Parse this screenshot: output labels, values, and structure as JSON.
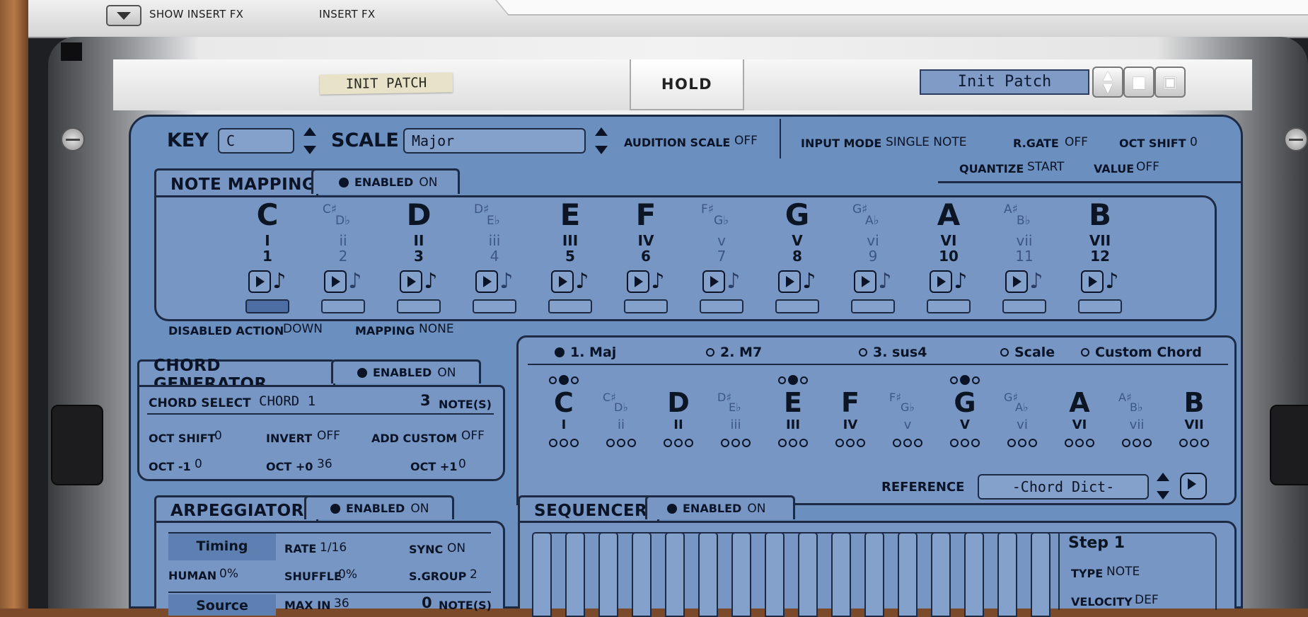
{
  "topbar": {
    "show_insert_fx": "SHOW INSERT FX",
    "insert_fx": "INSERT FX"
  },
  "header": {
    "patch_label": "INIT PATCH",
    "hold": "HOLD",
    "patch_name": "Init Patch"
  },
  "scale_bar": {
    "key_label": "KEY",
    "key_value": "C",
    "scale_label": "SCALE",
    "scale_value": "Major",
    "audition_label": "AUDITION SCALE",
    "audition_value": "OFF",
    "input_mode_label": "INPUT MODE",
    "input_mode_value": "SINGLE NOTE",
    "rgate_label": "R.GATE",
    "rgate_value": "OFF",
    "oct_shift_label": "OCT SHIFT",
    "oct_shift_value": "0",
    "quantize_label": "QUANTIZE",
    "quantize_value": "START",
    "value_label": "VALUE",
    "value_value": "OFF"
  },
  "note_mapping": {
    "title": "NOTE MAPPING",
    "enabled_label": "ENABLED",
    "enabled_value": "ON",
    "disabled_action_label": "DISABLED ACTION",
    "disabled_action_value": "DOWN",
    "mapping_label": "MAPPING",
    "mapping_value": "NONE",
    "notes": [
      {
        "name": "C",
        "sharp": "",
        "flat": "",
        "roman": "I",
        "num": "1",
        "dim": false
      },
      {
        "name": "",
        "sharp": "C♯",
        "flat": "D♭",
        "roman": "ii",
        "num": "2",
        "dim": true
      },
      {
        "name": "D",
        "sharp": "",
        "flat": "",
        "roman": "II",
        "num": "3",
        "dim": false
      },
      {
        "name": "",
        "sharp": "D♯",
        "flat": "E♭",
        "roman": "iii",
        "num": "4",
        "dim": true
      },
      {
        "name": "E",
        "sharp": "",
        "flat": "",
        "roman": "III",
        "num": "5",
        "dim": false
      },
      {
        "name": "F",
        "sharp": "",
        "flat": "",
        "roman": "IV",
        "num": "6",
        "dim": false
      },
      {
        "name": "",
        "sharp": "F♯",
        "flat": "G♭",
        "roman": "v",
        "num": "7",
        "dim": true
      },
      {
        "name": "G",
        "sharp": "",
        "flat": "",
        "roman": "V",
        "num": "8",
        "dim": false
      },
      {
        "name": "",
        "sharp": "G♯",
        "flat": "A♭",
        "roman": "vi",
        "num": "9",
        "dim": true
      },
      {
        "name": "A",
        "sharp": "",
        "flat": "",
        "roman": "VI",
        "num": "10",
        "dim": false
      },
      {
        "name": "",
        "sharp": "A♯",
        "flat": "B♭",
        "roman": "vii",
        "num": "11",
        "dim": true
      },
      {
        "name": "B",
        "sharp": "",
        "flat": "",
        "roman": "VII",
        "num": "12",
        "dim": false
      }
    ]
  },
  "chord_generator": {
    "title": "CHORD GENERATOR",
    "enabled_label": "ENABLED",
    "enabled_value": "ON",
    "chord_select_label": "CHORD SELECT",
    "chord_select_value": "CHORD 1",
    "note_count": "3",
    "notes_label": "NOTE(S)",
    "oct_shift_label": "OCT SHIFT",
    "oct_shift_value": "0",
    "invert_label": "INVERT",
    "invert_value": "OFF",
    "add_custom_label": "ADD CUSTOM",
    "add_custom_value": "OFF",
    "oct_m1_label": "OCT -1",
    "oct_m1_value": "0",
    "oct_0_label": "OCT +0",
    "oct_0_value": "36",
    "oct_p1_label": "OCT +1",
    "oct_p1_value": "0",
    "options": [
      {
        "label": "1. Maj",
        "selected": true
      },
      {
        "label": "2. M7",
        "selected": false
      },
      {
        "label": "3. sus4",
        "selected": false
      },
      {
        "label": "Scale",
        "selected": false
      },
      {
        "label": "Custom Chord",
        "selected": false
      }
    ],
    "reference_label": "REFERENCE",
    "reference_value": "-Chord Dict-",
    "columns": [
      {
        "name": "C",
        "sharp": "",
        "flat": "",
        "roman": "I",
        "active": true,
        "dim": false
      },
      {
        "name": "",
        "sharp": "C♯",
        "flat": "D♭",
        "roman": "ii",
        "active": false,
        "dim": true
      },
      {
        "name": "D",
        "sharp": "",
        "flat": "",
        "roman": "II",
        "active": false,
        "dim": false
      },
      {
        "name": "",
        "sharp": "D♯",
        "flat": "E♭",
        "roman": "iii",
        "active": false,
        "dim": true
      },
      {
        "name": "E",
        "sharp": "",
        "flat": "",
        "roman": "III",
        "active": true,
        "dim": false
      },
      {
        "name": "F",
        "sharp": "",
        "flat": "",
        "roman": "IV",
        "active": false,
        "dim": false
      },
      {
        "name": "",
        "sharp": "F♯",
        "flat": "G♭",
        "roman": "v",
        "active": false,
        "dim": true
      },
      {
        "name": "G",
        "sharp": "",
        "flat": "",
        "roman": "V",
        "active": true,
        "dim": false
      },
      {
        "name": "",
        "sharp": "G♯",
        "flat": "A♭",
        "roman": "vi",
        "active": false,
        "dim": true
      },
      {
        "name": "A",
        "sharp": "",
        "flat": "",
        "roman": "VI",
        "active": false,
        "dim": false
      },
      {
        "name": "",
        "sharp": "A♯",
        "flat": "B♭",
        "roman": "vii",
        "active": false,
        "dim": true
      },
      {
        "name": "B",
        "sharp": "",
        "flat": "",
        "roman": "VII",
        "active": false,
        "dim": false
      }
    ]
  },
  "arpeggiator": {
    "title": "ARPEGGIATOR",
    "enabled_label": "ENABLED",
    "enabled_value": "ON",
    "timing_tab": "Timing",
    "source_tab": "Source",
    "rate_label": "RATE",
    "rate_value": "1/16",
    "sync_label": "SYNC",
    "sync_value": "ON",
    "human_label": "HUMAN",
    "human_value": "0%",
    "shuffle_label": "SHUFFLE",
    "shuffle_value": "0%",
    "sgroup_label": "S.GROUP",
    "sgroup_value": "2",
    "max_in_label": "MAX IN",
    "max_in_value": "36",
    "notes_count": "0",
    "notes_label": "NOTE(S)"
  },
  "sequencer": {
    "title": "SEQUENCER",
    "enabled_label": "ENABLED",
    "enabled_value": "ON",
    "step_title": "Step 1",
    "type_label": "TYPE",
    "type_value": "NOTE",
    "velocity_label": "VELOCITY",
    "velocity_value": "DEF"
  },
  "colors": {
    "panel_blue": "#7796c4",
    "outline": "#1d2a44",
    "dim_text": "#3d5685"
  }
}
